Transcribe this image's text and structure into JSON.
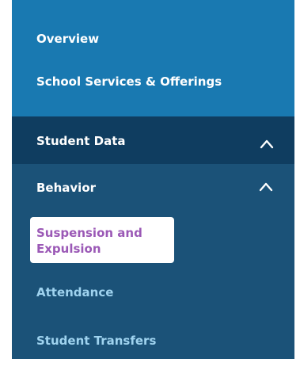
{
  "nav": {
    "overview": "Overview",
    "services": "School Services & Offerings",
    "student_data": "Student Data",
    "behavior": "Behavior",
    "sub_items": {
      "suspension": "Suspension and Expulsion",
      "attendance": "Attendance",
      "transfers": "Student Transfers"
    }
  },
  "icons": {
    "student_data_toggle": "chevron-up-icon",
    "behavior_toggle": "chevron-up-icon"
  },
  "colors": {
    "top_section_bg": "#1979b1",
    "panel_bg": "#1b5278",
    "student_data_bg": "#0f3d60",
    "sub_item_text": "#9fd3ef",
    "active_text": "#9b59b6"
  }
}
